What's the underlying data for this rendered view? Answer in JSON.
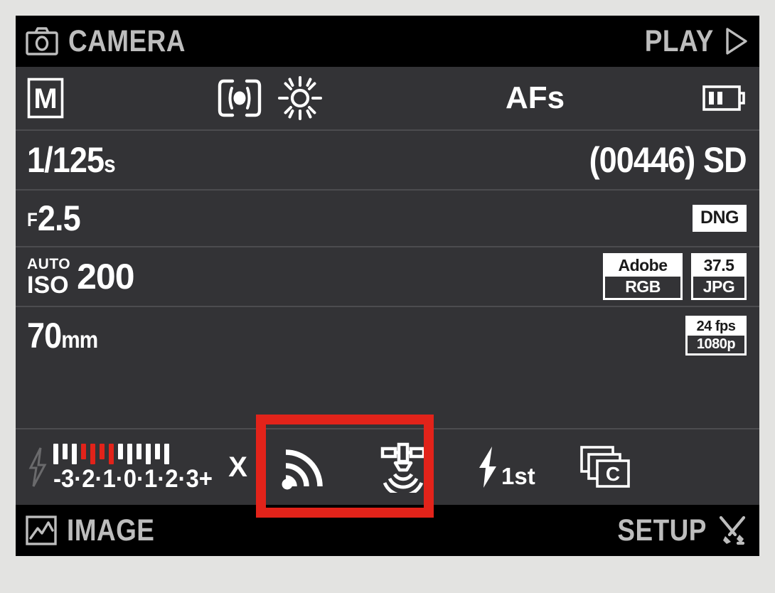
{
  "screen": {
    "header": {
      "left_icon": "camera-icon",
      "left_label": "CAMERA",
      "right_label": "PLAY",
      "right_icon": "play-triangle-icon"
    },
    "footer": {
      "left_icon": "image-picture-icon",
      "left_label": "IMAGE",
      "right_label": "SETUP",
      "right_icon": "tools-wrench-screwdriver-icon"
    },
    "rows": {
      "mode": {
        "exposure_mode": "M",
        "metering_icon": "spot-metering-icon",
        "white_balance_icon": "daylight-sun-icon",
        "focus_mode": "AFs",
        "battery_icon": "battery-icon",
        "battery_bars": 2
      },
      "shutter": {
        "value": "1/125",
        "unit": "s",
        "frames_remaining": "(00446)",
        "storage": "SD"
      },
      "aperture": {
        "prefix": "F",
        "value": "2.5",
        "file_format_badge": "DNG"
      },
      "iso": {
        "auto_label": "AUTO",
        "iso_label": "ISO",
        "value": "200",
        "color_space_top": "Adobe",
        "color_space_bottom": "RGB",
        "jpeg_size_top": "37.5",
        "jpeg_size_bottom": "JPG"
      },
      "focal": {
        "value": "70",
        "unit": "mm",
        "video_fps": "24 fps",
        "video_resolution": "1080p"
      },
      "status_icons": {
        "exposure_compensation": {
          "flash_icon": "flash-bolt-icon",
          "scale_labels": "-3·2·1·0·1·2·3+",
          "end_marker": "X",
          "ticks": [
            {
              "height": "tall",
              "color": "white"
            },
            {
              "height": "short",
              "color": "white"
            },
            {
              "height": "tall",
              "color": "white"
            },
            {
              "height": "short",
              "color": "red"
            },
            {
              "height": "tall",
              "color": "red"
            },
            {
              "height": "short",
              "color": "red"
            },
            {
              "height": "tall",
              "color": "red"
            },
            {
              "height": "short",
              "color": "white"
            },
            {
              "height": "tall",
              "color": "white"
            },
            {
              "height": "short",
              "color": "white"
            },
            {
              "height": "tall",
              "color": "white"
            },
            {
              "height": "short",
              "color": "white"
            },
            {
              "height": "tall",
              "color": "white"
            }
          ]
        },
        "wifi_icon": "wifi-signal-icon",
        "gps_icon": "gps-satellite-icon",
        "flash_sync_icon": "flash-bolt-icon",
        "flash_sync_label": "1st",
        "drive_mode_icon": "continuous-frames-icon",
        "drive_mode_letter": "C"
      }
    },
    "highlight": {
      "color": "#e2231a",
      "covers": "wifi-and-gps-icons"
    }
  },
  "colors": {
    "page_background": "#e3e3e1",
    "bar_background": "#000000",
    "panel_background": "#333336",
    "separator": "#4c4c4f",
    "text_primary": "#ffffff",
    "text_bar": "#bdbdbd",
    "accent_red": "#e2231a"
  }
}
